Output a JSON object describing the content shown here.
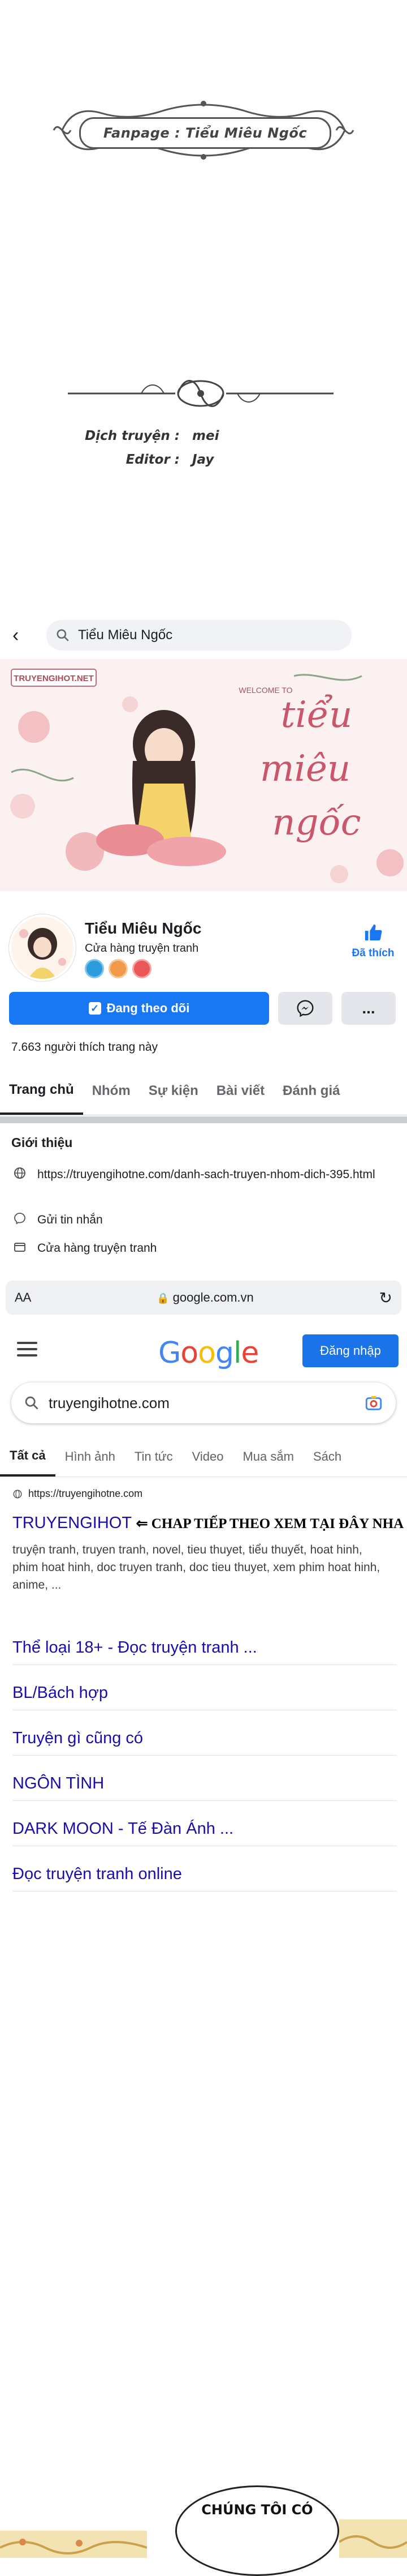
{
  "credits": {
    "fanpage": "Fanpage : Tiểu Miêu Ngốc",
    "translator_label": "Dịch truyện :",
    "translator": "mei",
    "editor_label": "Editor :",
    "editor": "Jay"
  },
  "facebook": {
    "search_text": "Tiểu Miêu Ngốc",
    "cover_site_text": "TRUYENGIHOT.NET",
    "cover_welcome": "WELCOME TO",
    "cover_logo_line1": "tiểu",
    "cover_logo_line2": "miêu",
    "cover_logo_line3": "ngốc",
    "page_name": "Tiểu Miêu Ngốc",
    "category": "Cửa hàng truyện tranh",
    "like_label": "Đã thích",
    "follow_label": "Đang theo dõi",
    "more_label": "...",
    "likes_count": "7.663 người thích trang này",
    "tabs": [
      "Trang chủ",
      "Nhóm",
      "Sự kiện",
      "Bài viết",
      "Đánh giá"
    ],
    "intro_title": "Giới thiệu",
    "intro_link": "https://truyengihotne.com/danh-sach-truyen-nhom-dich-395.html",
    "intro_message": "Gửi tin nhắn",
    "intro_category": "Cửa hàng truyện tranh"
  },
  "browser": {
    "aa": "AA",
    "url": "google.com.vn"
  },
  "google": {
    "logo_letters": [
      {
        "ch": "G",
        "color": "#4285F4"
      },
      {
        "ch": "o",
        "color": "#EA4335"
      },
      {
        "ch": "o",
        "color": "#FBBC05"
      },
      {
        "ch": "g",
        "color": "#4285F4"
      },
      {
        "ch": "l",
        "color": "#34A853"
      },
      {
        "ch": "e",
        "color": "#EA4335"
      }
    ],
    "signin": "Đăng nhập",
    "query": "truyengihotne.com",
    "tabs": [
      "Tất cả",
      "Hình ảnh",
      "Tin tức",
      "Video",
      "Mua sắm",
      "Sách"
    ],
    "site_url": "https://truyengihotne.com",
    "result_title": "TRUYENGIHOT",
    "result_overlay": "⇐ CHAP TIẾP THEO XEM TẠI ĐÂY NHA",
    "snippet": "truyện tranh, truyen tranh, novel, tieu thuyet, tiểu thuyết, hoat hinh, phim hoat hinh, doc truyen tranh, doc tieu thuyet, xem phim hoat hinh, anime, ...",
    "links": [
      "Thể loại 18+ - Đọc truyện tranh ...",
      "BL/Bách hợp",
      "Truyện gì cũng có",
      "NGÔN TÌNH",
      "DARK MOON - Tế Đàn Ánh ...",
      "Đọc truyện tranh online"
    ]
  },
  "comic": {
    "bubble_text": "CHÚNG TÔI CÓ"
  },
  "colors": {
    "facebook_blue": "#1877f2",
    "google_blue_link": "#1a0dab",
    "google_signin": "#1a73e8"
  }
}
